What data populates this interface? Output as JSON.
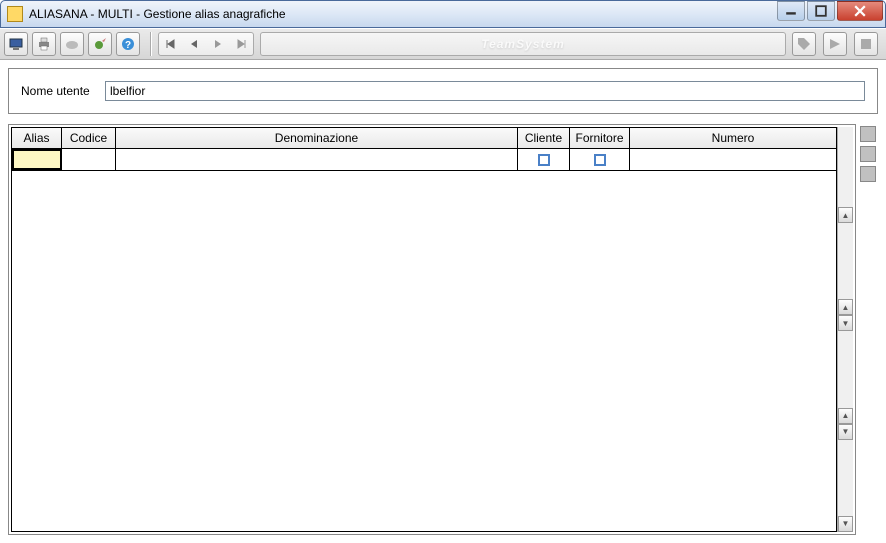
{
  "window": {
    "title": "ALIASANA  - MULTI -  Gestione alias anagrafiche"
  },
  "form": {
    "username_label": "Nome utente",
    "username_value": "lbelfior"
  },
  "grid": {
    "columns": {
      "alias": "Alias",
      "codice": "Codice",
      "denominazione": "Denominazione",
      "cliente": "Cliente",
      "fornitore": "Fornitore",
      "numero": "Numero"
    },
    "rows": [
      {
        "alias": "",
        "codice": "",
        "denominazione": "",
        "cliente": false,
        "fornitore": false,
        "numero": ""
      }
    ]
  },
  "brand": "TeamSystem"
}
